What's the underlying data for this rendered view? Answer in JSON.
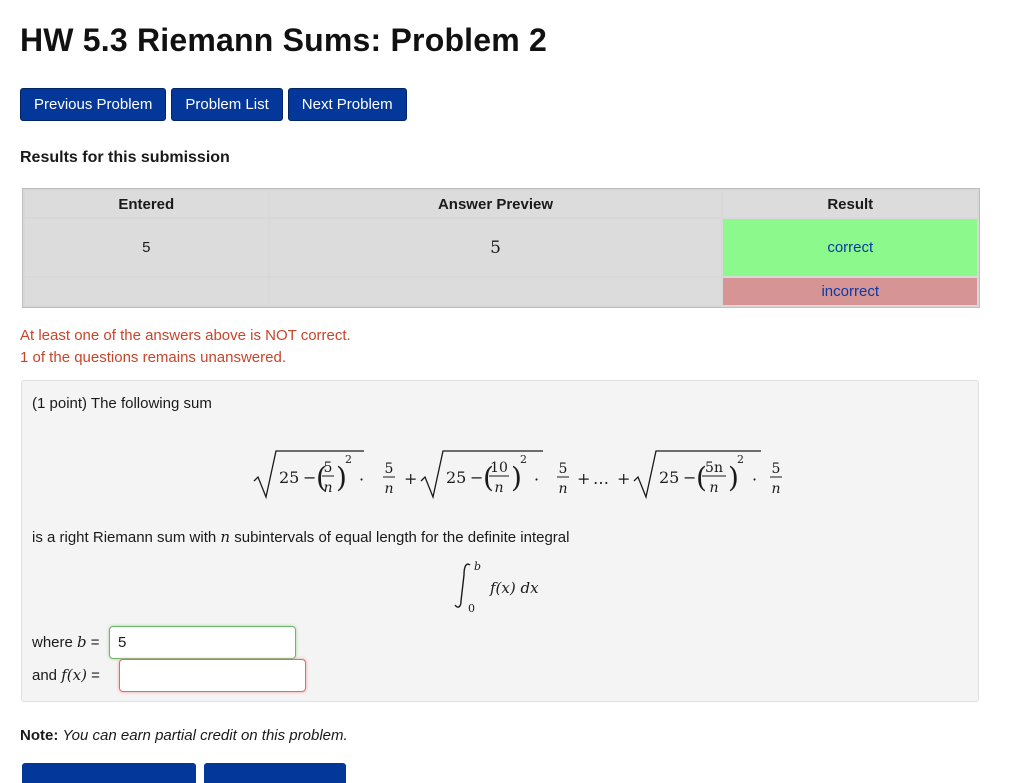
{
  "page": {
    "title": "HW 5.3 Riemann Sums: Problem 2"
  },
  "nav": {
    "previous": "Previous Problem",
    "list": "Problem List",
    "next": "Next Problem"
  },
  "results": {
    "heading": "Results for this submission",
    "columns": [
      "Entered",
      "Answer Preview",
      "Result"
    ],
    "rows": [
      {
        "entered": "5",
        "preview": "5",
        "result": "correct"
      },
      {
        "entered": "",
        "preview": "",
        "result": "incorrect"
      }
    ],
    "messages": [
      "At least one of the answers above is NOT correct.",
      "1 of the questions remains unanswered."
    ]
  },
  "problem": {
    "intro": "(1 point) The following sum",
    "statement_prefix": "is a right Riemann sum with ",
    "statement_var": "n",
    "statement_suffix": " subintervals of equal length for the definite integral",
    "b_label_prefix": "where ",
    "b_label_var": "b",
    "b_label_suffix": " =",
    "b_value": "5",
    "f_label_prefix": "and ",
    "f_label_var": "f(x)",
    "f_label_suffix": " =",
    "f_value": "",
    "math": {
      "sqrt_const": "25",
      "minus": "−",
      "t1_num": "5",
      "t2_num": "10",
      "t3_num": "5n",
      "den": "n",
      "exp": "2",
      "dot": "·",
      "plus": "+",
      "ellipsis": "…",
      "int_upper": "b",
      "int_lower": "0",
      "integrand": "f(x) dx"
    }
  },
  "note": {
    "label": "Note:",
    "text": "You can earn partial credit on this problem."
  },
  "colors": {
    "button": "#04379a",
    "correct": "#8bf98b",
    "incorrect": "#d69494",
    "warning_text": "#c7452b"
  }
}
